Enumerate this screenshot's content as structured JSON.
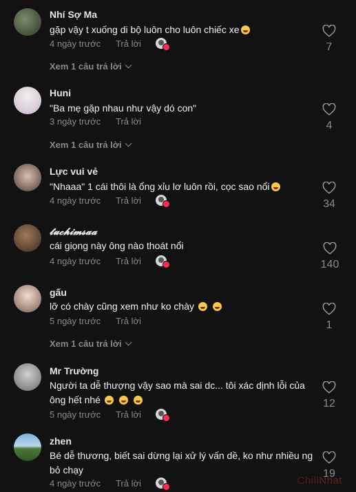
{
  "comments": [
    {
      "username": "Nhí Sợ Ma",
      "text": "gặp vậy t xuống di bộ luôn cho luôn chiếc xe",
      "emoji_after": "grin",
      "time": "4 ngày trước",
      "reply": "Trả lời",
      "likes": "7",
      "view_replies": "Xem 1 câu trả lời"
    },
    {
      "username": "Huni",
      "text": "\"Ba mẹ gặp nhau như vậy dó con\"",
      "time": "3 ngày trước",
      "reply": "Trả lời",
      "likes": "4",
      "view_replies": "Xem 1 câu trả lời"
    },
    {
      "username": "Lực vui vẻ",
      "text": "\"Nhaaa\" 1 cái thôi là ổng xỉu lơ luôn rồi, cọc sao nổi",
      "emoji_after": "grin",
      "time": "4 ngày trước",
      "reply": "Trả lời",
      "likes": "34"
    },
    {
      "username": "𝓽𝓾𝓬𝓱𝓲𝓶𝓼𝓪𝓪",
      "text": "cái giọng này ông nào thoát nổi",
      "time": "4 ngày trước",
      "reply": "Trả lời",
      "likes": "140"
    },
    {
      "username": "gấu",
      "text": "lỡ có chày cũng xem như ko chày",
      "time": "5 ngày trước",
      "reply": "Trả lời",
      "likes": "1",
      "view_replies": "Xem 1 câu trả lời"
    },
    {
      "username": "Mr Trường",
      "text": "Người ta dễ thượng vậy sao mà sai dc... tôi xác dịnh lỗi của ông hết nhé",
      "time": "5 ngày trước",
      "reply": "Trả lời",
      "likes": "12"
    },
    {
      "username": "zhen",
      "text": "Bé dễ thương, biết sai dừng lại xử lý vấn dề, ko như nhiều ng bỏ chạy",
      "time": "4 ngày trước",
      "reply": "Trả lời",
      "likes": "19"
    }
  ],
  "watermark": {
    "part1": "Chill",
    "part2": "Nhat"
  },
  "colors": {
    "background": "#121212",
    "muted": "#8a8a8a",
    "accent": "#fe2c55"
  }
}
